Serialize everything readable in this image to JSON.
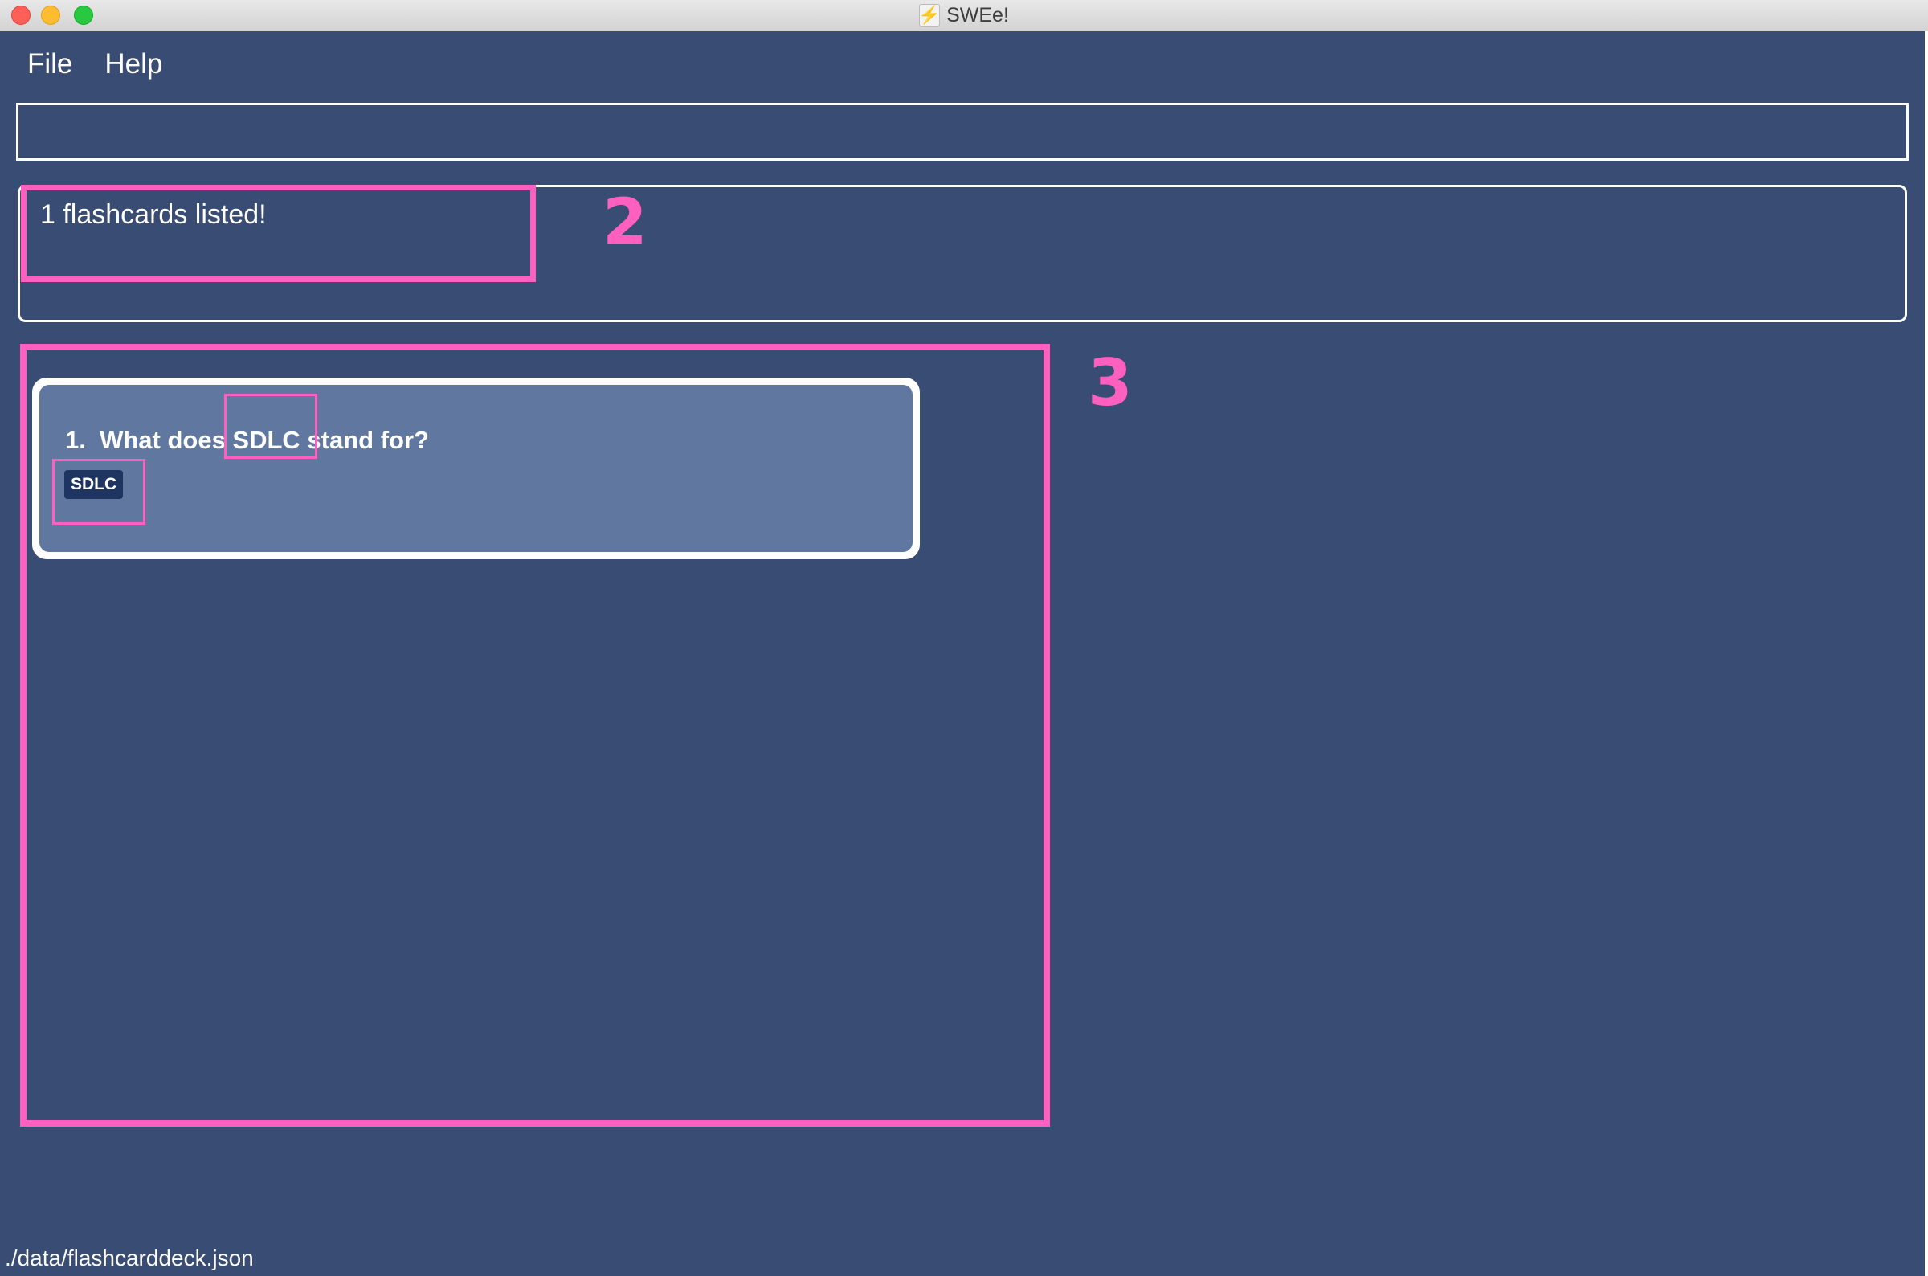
{
  "window": {
    "title": "SWEe!",
    "app_icon_glyph": "⚡"
  },
  "menu": {
    "items": [
      {
        "label": "File"
      },
      {
        "label": "Help"
      }
    ]
  },
  "command_box": {
    "value": "",
    "placeholder": ""
  },
  "result": {
    "message": "1 flashcards listed!"
  },
  "annotations": {
    "label_2": "2",
    "label_3": "3",
    "color": "#ff5fbf"
  },
  "flashcards": [
    {
      "index": "1.",
      "question": "What does SDLC stand for?",
      "tag": "SDLC"
    }
  ],
  "status": {
    "path": "./data/flashcarddeck.json"
  },
  "colors": {
    "background": "#394c73",
    "card": "#6078a0",
    "tag": "#1e3561"
  }
}
